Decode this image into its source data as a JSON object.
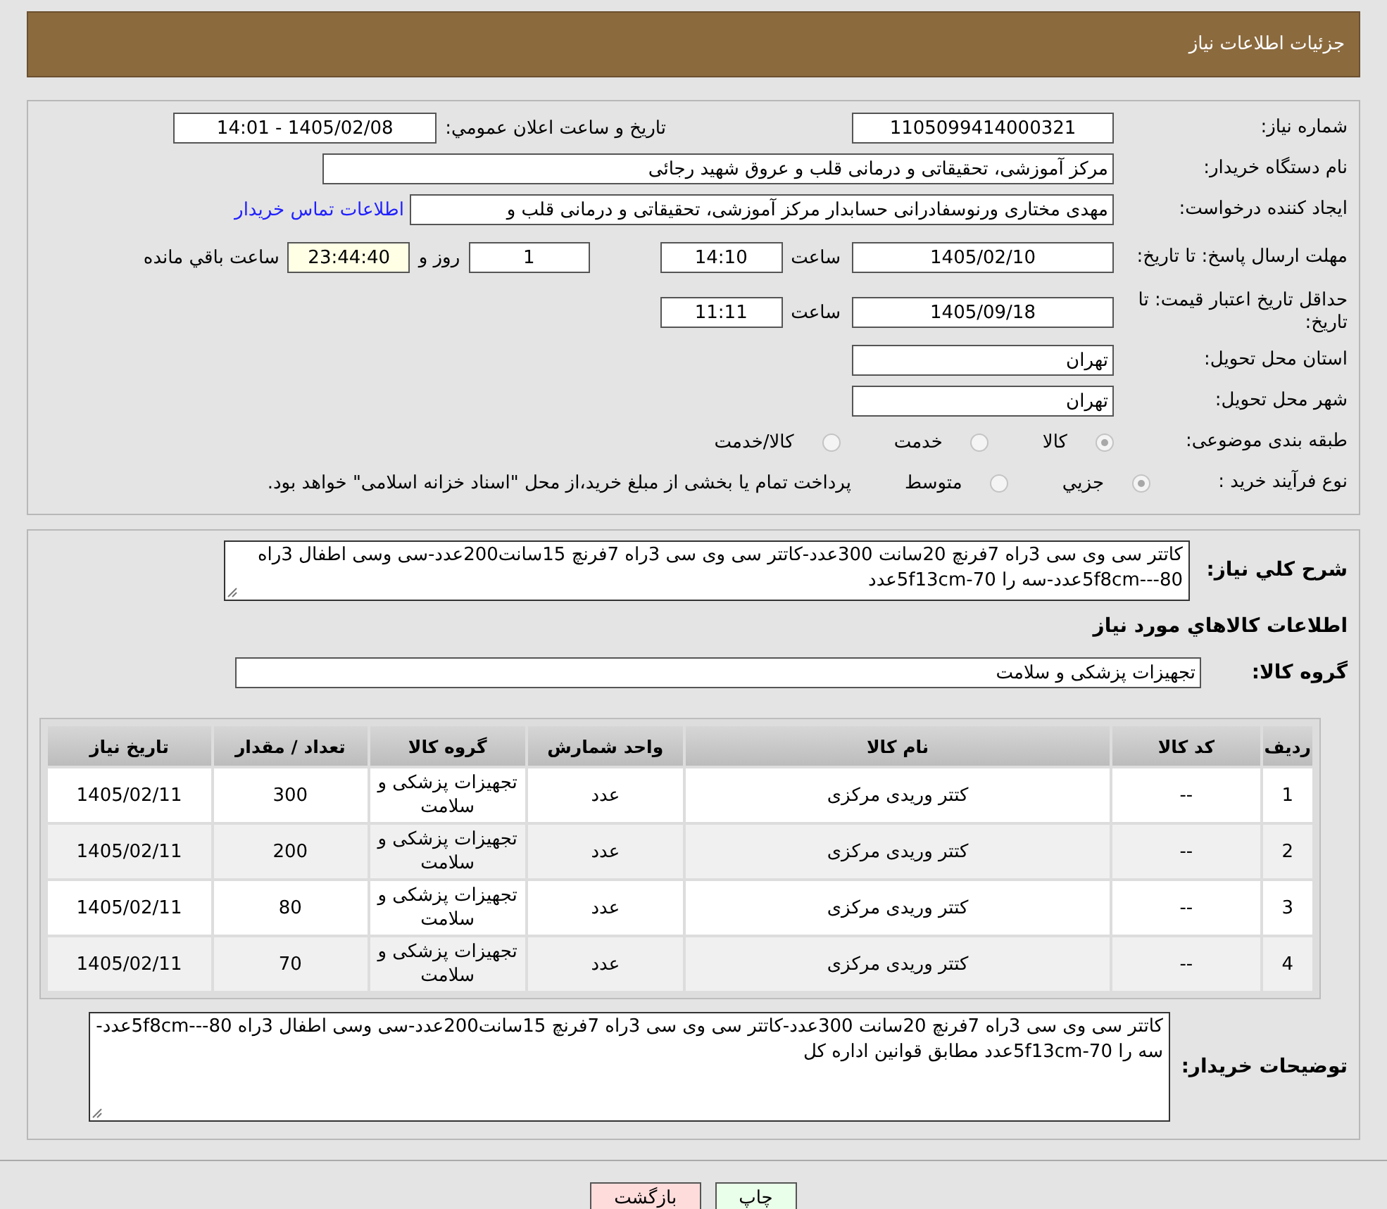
{
  "header": {
    "title": "جزئیات اطلاعات نیاز"
  },
  "need_number": {
    "label": "شماره نیاز:",
    "value": "1105099414000321"
  },
  "announce": {
    "label": "تاريخ و ساعت اعلان عمومي:",
    "value": "1405/02/08 - 14:01"
  },
  "buyer": {
    "label": "نام دستگاه خریدار:",
    "value": "مرکز آموزشی، تحقیقاتی و درمانی قلب و عروق شهید رجائی"
  },
  "creator": {
    "label": "ایجاد کننده درخواست:",
    "value": "مهدی مختاری ورنوسفادرانی حسابدار مرکز آموزشی، تحقیقاتی و درمانی قلب و",
    "link": "اطلاعات تماس خریدار"
  },
  "deadline": {
    "label": "مهلت ارسال پاسخ: تا تاریخ:",
    "date": "1405/02/10",
    "time_label": "ساعت",
    "time": "14:10",
    "days": "1",
    "days_label": "روز و",
    "remaining": "23:44:40",
    "remaining_label": "ساعت باقي مانده"
  },
  "validity": {
    "label": "حداقل تاریخ اعتبار قیمت: تا تاریخ:",
    "date": "1405/09/18",
    "time_label": "ساعت",
    "time": "11:11"
  },
  "province": {
    "label": "استان محل تحویل:",
    "value": "تهران"
  },
  "city": {
    "label": "شهر محل تحویل:",
    "value": "تهران"
  },
  "category": {
    "label": "طبقه بندی موضوعی:",
    "options": [
      {
        "label": "کالا",
        "selected": true
      },
      {
        "label": "خدمت",
        "selected": false
      },
      {
        "label": "کالا/خدمت",
        "selected": false
      }
    ]
  },
  "process": {
    "label": "نوع فرآیند خرید :",
    "options": [
      {
        "label": "جزيي",
        "selected": true
      },
      {
        "label": "متوسط",
        "selected": false
      }
    ],
    "note": "پرداخت تمام یا بخشی از مبلغ خرید،از محل \"اسناد خزانه اسلامی\" خواهد بود."
  },
  "summary": {
    "label": "شرح کلي نياز:",
    "value": "کاتتر سی وی سی 3راه 7فرنچ 20سانت 300عدد-کاتتر سی وی سی 3راه 7فرنچ 15سانت200عدد-سی وسی اطفال 3راه 80---5f8cmعدد-سه را 70-5f13cmعدد"
  },
  "goods_heading": "اطلاعات کالاهاي مورد نياز",
  "goods_group": {
    "label": "گروه کالا:",
    "value": "تجهیزات پزشکی و سلامت"
  },
  "table": {
    "columns": [
      "رديف",
      "کد کالا",
      "نام کالا",
      "واحد شمارش",
      "گروه کالا",
      "تعداد / مقدار",
      "تاريخ نياز"
    ],
    "rows": [
      [
        "1",
        "--",
        "کتتر وریدی مرکزی",
        "عدد",
        "تجهیزات پزشکی و سلامت",
        "300",
        "1405/02/11"
      ],
      [
        "2",
        "--",
        "کتتر وریدی مرکزی",
        "عدد",
        "تجهیزات پزشکی و سلامت",
        "200",
        "1405/02/11"
      ],
      [
        "3",
        "--",
        "کتتر وریدی مرکزی",
        "عدد",
        "تجهیزات پزشکی و سلامت",
        "80",
        "1405/02/11"
      ],
      [
        "4",
        "--",
        "کتتر وریدی مرکزی",
        "عدد",
        "تجهیزات پزشکی و سلامت",
        "70",
        "1405/02/11"
      ]
    ]
  },
  "buyer_notes": {
    "label": "توضیحات خریدار:",
    "value": "کاتتر سی وی سی 3راه 7فرنچ 20سانت 300عدد-کاتتر سی وی سی 3راه 7فرنچ 15سانت200عدد-سی وسی اطفال 3راه 80---5f8cmعدد-سه را 70-5f13cmعدد مطابق قوانین اداره کل"
  },
  "buttons": [
    {
      "label": "چاپ",
      "kind": "print"
    },
    {
      "label": "بازگشت",
      "kind": "back"
    }
  ]
}
